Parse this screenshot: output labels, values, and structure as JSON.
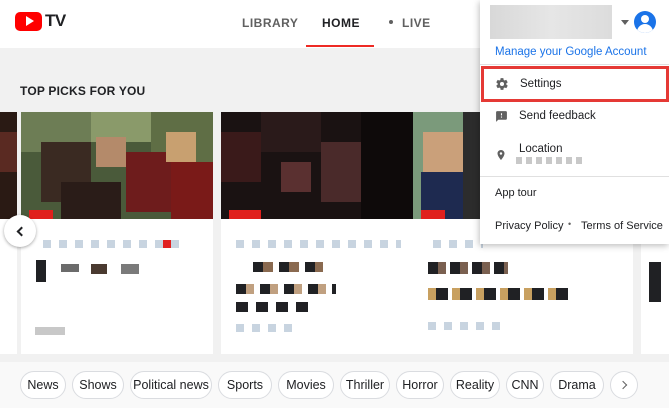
{
  "app": {
    "logo_text": "TV"
  },
  "nav": {
    "tabs": [
      {
        "label": "LIBRARY"
      },
      {
        "label": "HOME"
      },
      {
        "label": "LIVE"
      }
    ],
    "active": "HOME"
  },
  "section": {
    "title": "TOP PICKS FOR YOU"
  },
  "account_menu": {
    "manage_link": "Manage your Google Account",
    "items": [
      {
        "label": "Settings",
        "icon": "gear-icon"
      },
      {
        "label": "Send feedback",
        "icon": "feedback-icon"
      },
      {
        "label": "Location",
        "icon": "location-pin-icon"
      }
    ],
    "app_tour": "App tour",
    "privacy": "Privacy Policy",
    "separator": "•",
    "terms": "Terms of Service"
  },
  "chips": [
    "News",
    "Shows",
    "Political news",
    "Sports",
    "Movies",
    "Thriller",
    "Horror",
    "Reality",
    "CNN",
    "Drama"
  ],
  "colors": {
    "accent": "#ee2a24",
    "link": "#1a73e8",
    "highlight": "#e53935"
  }
}
